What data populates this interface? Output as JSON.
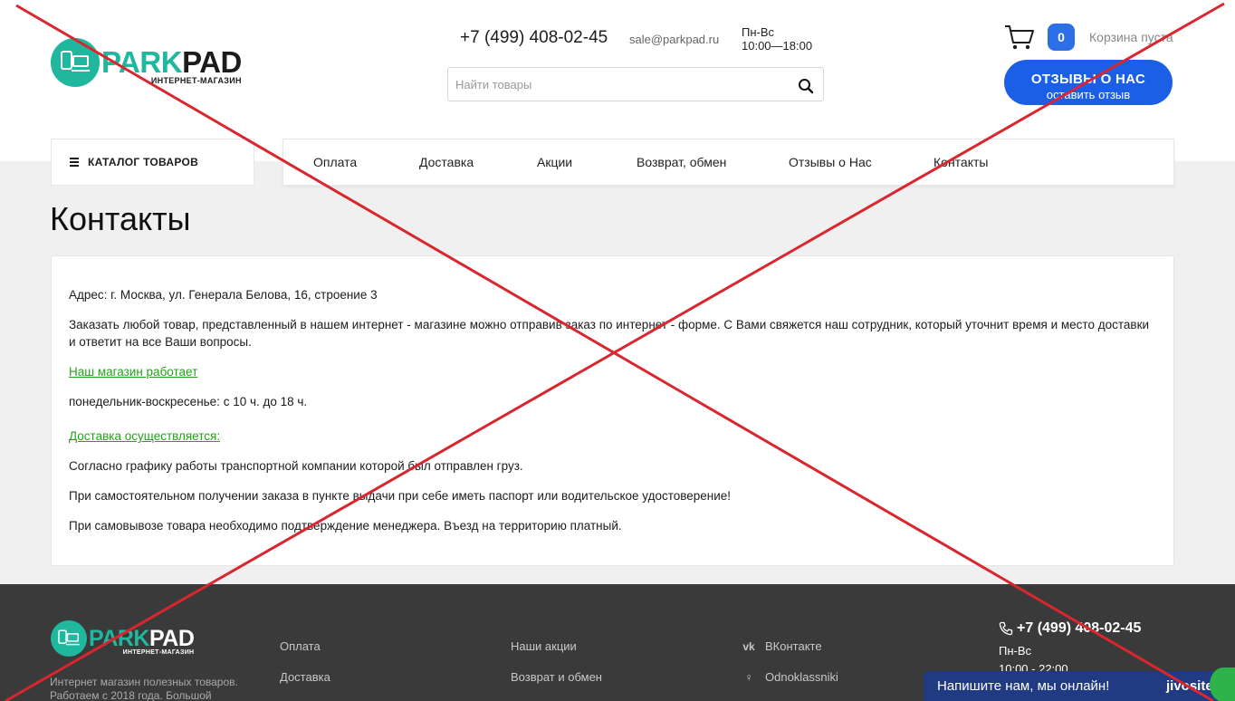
{
  "header": {
    "logo": {
      "brand_part1": "PARK",
      "brand_part2": "PAD",
      "subtitle": "ИНТЕРНЕТ-МАГАЗИН"
    },
    "phone": "+7 (499) 408-02-45",
    "email": "sale@parkpad.ru",
    "days": "Пн-Вс",
    "hours": "10:00—18:00",
    "search_placeholder": "Найти товары",
    "cart_count": "0",
    "cart_label": "Корзина пуста",
    "reviews_button": {
      "line1": "ОТЗЫВЫ О НАС",
      "line2": "оставить отзыв"
    }
  },
  "catalog_label": "КАТАЛОГ ТОВАРОВ",
  "nav": {
    "items": [
      {
        "label": "Оплата"
      },
      {
        "label": "Доставка"
      },
      {
        "label": "Акции"
      },
      {
        "label": "Возврат, обмен"
      },
      {
        "label": "Отзывы о Нас"
      },
      {
        "label": "Контакты"
      }
    ]
  },
  "page_title": "Контакты",
  "content": {
    "address": "Адрес: г. Москва, ул. Генерала Белова, 16, строение 3",
    "order_info": "Заказать любой товар, представленный в нашем интернет - магазине можно отправив заказ по интернет - форме. С Вами свяжется наш сотрудник, который уточнит время и место доставки и ответит на все Ваши вопросы.",
    "works_heading": "Наш магазин работает",
    "works_hours": "понедельник-воскресенье: с 10 ч. до 18 ч.",
    "delivery_heading": "Доставка осуществляется:",
    "delivery_line1": "Согласно графику работы транспортной компании которой был отправлен груз.",
    "delivery_line2": "При самостоятельном получении заказа в пункте выдачи при себе иметь паспорт или водительское удостоверение!",
    "delivery_line3": "При самовывозе товара необходимо подтверждение менеджера. Въезд на территорию платный."
  },
  "footer": {
    "logo": {
      "brand_part1": "PARK",
      "brand_part2": "PAD",
      "subtitle": "ИНТЕРНЕТ-МАГАЗИН"
    },
    "description": "Интернет магазин полезных товаров. Работаем с 2018 года. Большой",
    "col1": [
      "Оплата",
      "Доставка"
    ],
    "col2": [
      "Наши акции",
      "Возврат и обмен"
    ],
    "social": [
      {
        "label": "ВКонтакте",
        "icon": "vk-icon"
      },
      {
        "label": "Odnoklassniki",
        "icon": "odnoklassniki-icon"
      }
    ],
    "phone": "+7 (499) 408-02-45",
    "days": "Пн-Вс",
    "hours": "10:00 - 22:00"
  },
  "chat": {
    "text": "Напишите нам, мы онлайн!",
    "brand": "jivosite"
  },
  "colors": {
    "accent_blue": "#1b5fe6",
    "brand_green": "#1fb79d",
    "link_green": "#26a11c",
    "cross_red": "#d9262f"
  }
}
